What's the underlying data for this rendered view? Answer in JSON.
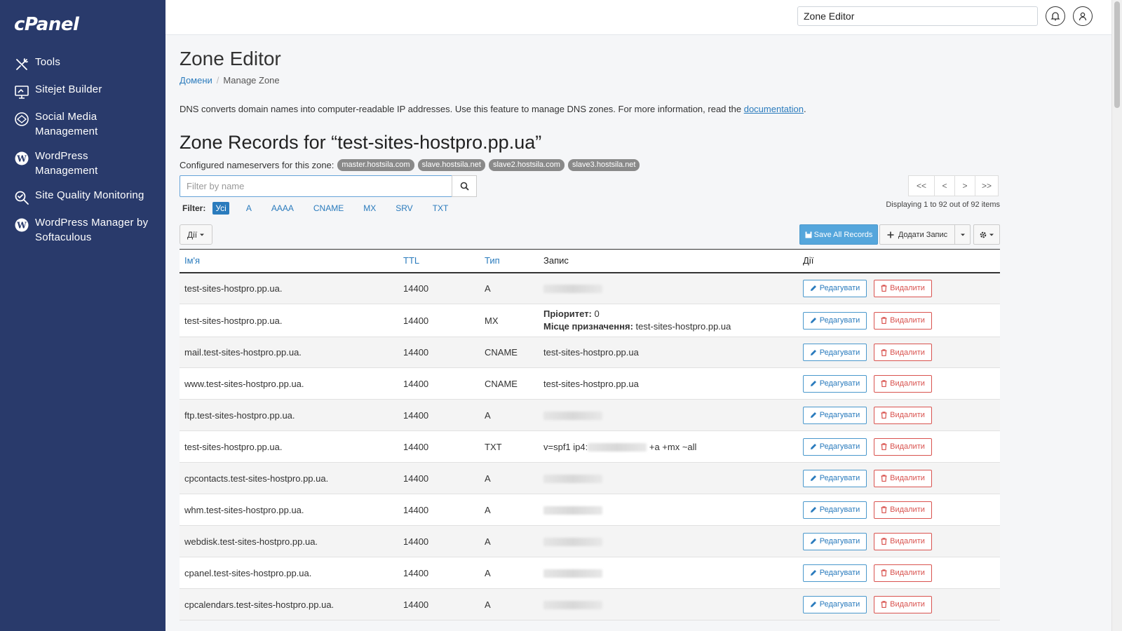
{
  "app": {
    "logo": "cPanel"
  },
  "sidebar": {
    "items": [
      {
        "label": "Tools",
        "icon": "tools-icon"
      },
      {
        "label": "Sitejet Builder",
        "icon": "monitor-icon"
      },
      {
        "label": "Social Media Management",
        "icon": "social-icon"
      },
      {
        "label": "WordPress Management",
        "icon": "wordpress-icon"
      },
      {
        "label": "Site Quality Monitoring",
        "icon": "magnifier-icon"
      },
      {
        "label": "WordPress Manager by Softaculous",
        "icon": "wordpress-icon"
      }
    ]
  },
  "header": {
    "search_value": "Zone Editor"
  },
  "page": {
    "title": "Zone Editor",
    "breadcrumb": {
      "link": "Домени",
      "current": "Manage Zone"
    },
    "description": "DNS converts domain names into computer-readable IP addresses. Use this feature to manage DNS zones. For more information, read the",
    "description_link": "documentation",
    "description_end": "."
  },
  "zone": {
    "title": "Zone Records for “test-sites-hostpro.pp.ua”",
    "ns_label": "Configured nameservers for this zone:",
    "nameservers": [
      "master.hostsila.com",
      "slave.hostsila.net",
      "slave2.hostsila.com",
      "slave3.hostsila.net"
    ]
  },
  "filter": {
    "placeholder": "Filter by name",
    "label": "Filter:",
    "types": [
      "Усі",
      "A",
      "AAAA",
      "CNAME",
      "MX",
      "SRV",
      "TXT"
    ],
    "active": "Усі"
  },
  "pager": {
    "buttons": [
      "<<",
      "<",
      ">",
      ">>"
    ],
    "info": "Displaying 1 to 92 out of 92 items"
  },
  "toolbar": {
    "actions_label": "Дії",
    "save_label": "Save All Records",
    "add_label": "Додати Запис"
  },
  "table": {
    "headers": {
      "name": "Ім'я",
      "ttl": "TTL",
      "type": "Тип",
      "record": "Запис",
      "actions": "Дії"
    },
    "edit_label": "Редагувати",
    "delete_label": "Видалити",
    "mx_priority_label": "Пріоритет:",
    "mx_dest_label": "Місце призначення:",
    "rows": [
      {
        "name": "test-sites-hostpro.pp.ua.",
        "ttl": "14400",
        "type": "A",
        "record": ""
      },
      {
        "name": "test-sites-hostpro.pp.ua.",
        "ttl": "14400",
        "type": "MX",
        "priority": "0",
        "dest": "test-sites-hostpro.pp.ua"
      },
      {
        "name": "mail.test-sites-hostpro.pp.ua.",
        "ttl": "14400",
        "type": "CNAME",
        "record": "test-sites-hostpro.pp.ua"
      },
      {
        "name": "www.test-sites-hostpro.pp.ua.",
        "ttl": "14400",
        "type": "CNAME",
        "record": "test-sites-hostpro.pp.ua"
      },
      {
        "name": "ftp.test-sites-hostpro.pp.ua.",
        "ttl": "14400",
        "type": "A",
        "record": ""
      },
      {
        "name": "test-sites-hostpro.pp.ua.",
        "ttl": "14400",
        "type": "TXT",
        "txt_prefix": "v=spf1 ip4:",
        "txt_suffix": "+a +mx ~all"
      },
      {
        "name": "cpcontacts.test-sites-hostpro.pp.ua.",
        "ttl": "14400",
        "type": "A",
        "record": ""
      },
      {
        "name": "whm.test-sites-hostpro.pp.ua.",
        "ttl": "14400",
        "type": "A",
        "record": ""
      },
      {
        "name": "webdisk.test-sites-hostpro.pp.ua.",
        "ttl": "14400",
        "type": "A",
        "record": ""
      },
      {
        "name": "cpanel.test-sites-hostpro.pp.ua.",
        "ttl": "14400",
        "type": "A",
        "record": ""
      },
      {
        "name": "cpcalendars.test-sites-hostpro.pp.ua.",
        "ttl": "14400",
        "type": "A",
        "record": ""
      }
    ]
  },
  "colors": {
    "sidebar": "#293a6b",
    "link": "#2a7bbd",
    "danger": "#d9534f",
    "primary": "#55a6dc"
  }
}
